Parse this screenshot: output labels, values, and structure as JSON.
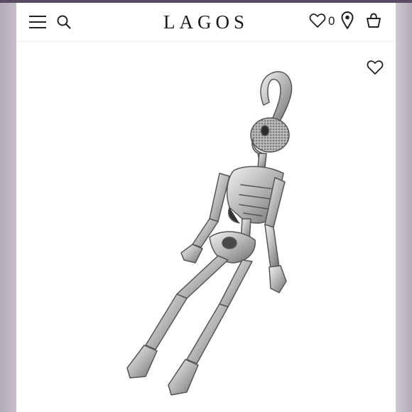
{
  "header": {
    "brand_logo": "LAGOS",
    "wishlist_count": "0",
    "icons": {
      "menu": "hamburger-menu-icon",
      "search": "search-icon",
      "wishlist": "heart-icon",
      "location": "map-pin-icon",
      "bag": "shopping-bag-icon"
    }
  },
  "product": {
    "image": "sterling-silver-skeleton-pendant",
    "favorite_icon": "heart-outline-icon"
  },
  "colors": {
    "frame": "#5a4a63",
    "background": "#ffffff",
    "text": "#1a1a1a"
  }
}
